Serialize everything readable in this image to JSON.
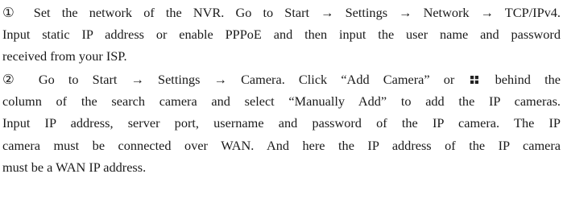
{
  "paragraphs": [
    {
      "lines": [
        "① Set the network of the NVR. Go to Start → Settings → Network → TCP/IPv4.",
        "Input static IP address or enable PPPoE and then input the user name and password",
        "received from your ISP."
      ]
    },
    {
      "line1_before_icon": "② Go to Start → Settings → Camera. Click “Add Camera” or",
      "line1_after_icon": "behind the",
      "icon": "plus-square-icon",
      "lines": [
        "column of the search camera and select “Manually Add” to add the IP cameras.",
        "Input IP address, server port, username and password of the IP camera. The IP",
        "camera must be connected over WAN. And here the IP address of the IP camera",
        "must be a WAN IP address."
      ]
    }
  ]
}
